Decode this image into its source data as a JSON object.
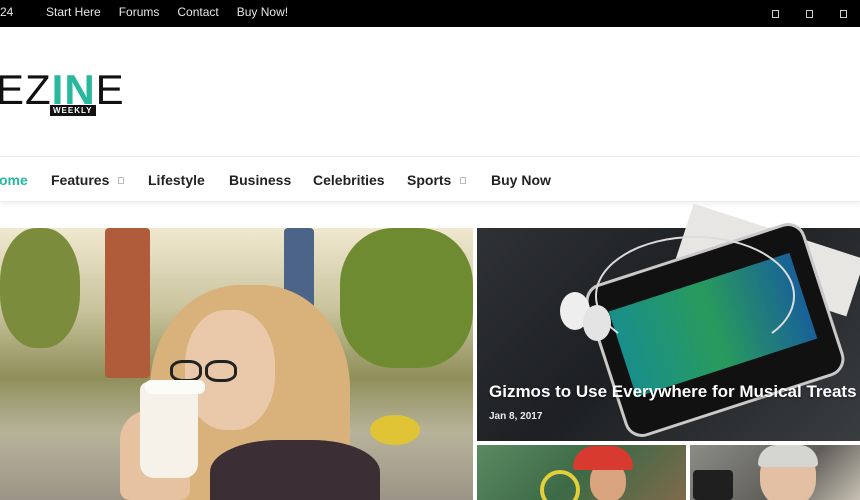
{
  "topbar": {
    "date_fragment": "24",
    "links": [
      "Start Here",
      "Forums",
      "Contact",
      "Buy Now!"
    ],
    "social_icons": [
      "social-icon-1",
      "social-icon-2",
      "social-icon-3"
    ]
  },
  "brand": {
    "logo_text_plain": "EZ",
    "logo_text_accent": "IN",
    "logo_text_tail": "E",
    "logo_sub": "WEEKLY",
    "accent_color": "#27b89d"
  },
  "nav": {
    "items": [
      {
        "label": "ome",
        "active": true
      },
      {
        "label": "Features",
        "dropdown": true
      },
      {
        "label": "Lifestyle"
      },
      {
        "label": "Business"
      },
      {
        "label": "Celebrities"
      },
      {
        "label": "Sports",
        "dropdown": true
      },
      {
        "label": "Buy Now"
      }
    ]
  },
  "featured": {
    "gizmo": {
      "title": "Gizmos to Use Everywhere for Musical Treats",
      "date": "Jan 8, 2017"
    }
  }
}
